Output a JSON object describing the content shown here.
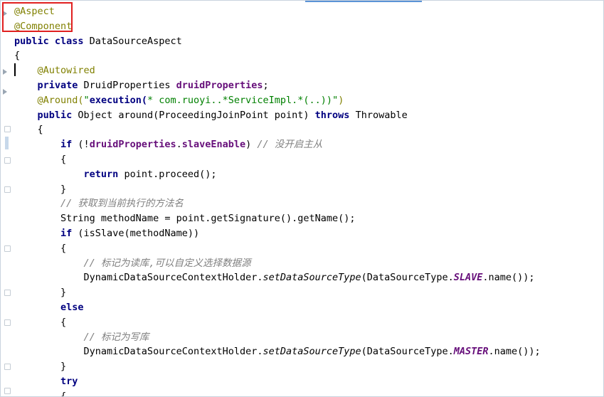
{
  "editor": {
    "lines": [
      [
        {
          "t": "@Aspect",
          "c": "ann"
        }
      ],
      [
        {
          "t": "@Component",
          "c": "ann"
        }
      ],
      [
        {
          "t": "public class ",
          "c": "kw"
        },
        {
          "t": "DataSourceAspect",
          "c": ""
        }
      ],
      [
        {
          "t": "{",
          "c": ""
        }
      ],
      [
        {
          "t": "    ",
          "c": ""
        },
        {
          "t": "@Autowired",
          "c": "ann"
        }
      ],
      [
        {
          "t": "    ",
          "c": ""
        },
        {
          "t": "private ",
          "c": "kw"
        },
        {
          "t": "DruidProperties ",
          "c": ""
        },
        {
          "t": "druidProperties",
          "c": "field"
        },
        {
          "t": ";",
          "c": ""
        }
      ],
      [
        {
          "t": "    ",
          "c": ""
        },
        {
          "t": "@Around(",
          "c": "ann"
        },
        {
          "t": "\"",
          "c": "strn"
        },
        {
          "t": "execution(",
          "c": "strb"
        },
        {
          "t": "* com.ruoyi..*ServiceImpl.*(..))",
          "c": "strn"
        },
        {
          "t": "\"",
          "c": "strn"
        },
        {
          "t": ")",
          "c": "ann"
        }
      ],
      [
        {
          "t": "    ",
          "c": ""
        },
        {
          "t": "public ",
          "c": "kw"
        },
        {
          "t": "Object around(ProceedingJoinPoint point) ",
          "c": ""
        },
        {
          "t": "throws ",
          "c": "kw"
        },
        {
          "t": "Throwable",
          "c": ""
        }
      ],
      [
        {
          "t": "    {",
          "c": ""
        }
      ],
      [
        {
          "t": "        ",
          "c": ""
        },
        {
          "t": "if ",
          "c": "kw"
        },
        {
          "t": "(!",
          "c": ""
        },
        {
          "t": "druidProperties",
          "c": "field"
        },
        {
          "t": ".",
          "c": ""
        },
        {
          "t": "slaveEnable",
          "c": "field"
        },
        {
          "t": ") ",
          "c": ""
        },
        {
          "t": "// 没开启主从",
          "c": "cmt"
        }
      ],
      [
        {
          "t": "        {",
          "c": ""
        }
      ],
      [
        {
          "t": "            ",
          "c": ""
        },
        {
          "t": "return ",
          "c": "kw"
        },
        {
          "t": "point.proceed();",
          "c": ""
        }
      ],
      [
        {
          "t": "        }",
          "c": ""
        }
      ],
      [
        {
          "t": "        ",
          "c": ""
        },
        {
          "t": "// 获取到当前执行的方法名",
          "c": "cmt"
        }
      ],
      [
        {
          "t": "        String methodName = point.getSignature().getName();",
          "c": ""
        }
      ],
      [
        {
          "t": "        ",
          "c": ""
        },
        {
          "t": "if ",
          "c": "kw"
        },
        {
          "t": "(isSlave(methodName))",
          "c": ""
        }
      ],
      [
        {
          "t": "        {",
          "c": ""
        }
      ],
      [
        {
          "t": "            ",
          "c": ""
        },
        {
          "t": "// 标记为读库,可以自定义选择数据源",
          "c": "cmt"
        }
      ],
      [
        {
          "t": "            DynamicDataSourceContextHolder.",
          "c": ""
        },
        {
          "t": "setDataSourceType",
          "c": "ital"
        },
        {
          "t": "(DataSourceType.",
          "c": ""
        },
        {
          "t": "SLAVE",
          "c": "const"
        },
        {
          "t": ".name());",
          "c": ""
        }
      ],
      [
        {
          "t": "        }",
          "c": ""
        }
      ],
      [
        {
          "t": "        ",
          "c": ""
        },
        {
          "t": "else",
          "c": "kw"
        }
      ],
      [
        {
          "t": "        {",
          "c": ""
        }
      ],
      [
        {
          "t": "            ",
          "c": ""
        },
        {
          "t": "// 标记为写库",
          "c": "cmt"
        }
      ],
      [
        {
          "t": "            DynamicDataSourceContextHolder.",
          "c": ""
        },
        {
          "t": "setDataSourceType",
          "c": "ital"
        },
        {
          "t": "(DataSourceType.",
          "c": ""
        },
        {
          "t": "MASTER",
          "c": "const"
        },
        {
          "t": ".name());",
          "c": ""
        }
      ],
      [
        {
          "t": "        }",
          "c": ""
        }
      ],
      [
        {
          "t": "        ",
          "c": ""
        },
        {
          "t": "try",
          "c": "kw"
        }
      ],
      [
        {
          "t": "        {",
          "c": ""
        }
      ]
    ]
  },
  "colors": {
    "keyword": "#000080",
    "annotation": "#808000",
    "field": "#660e7a",
    "comment": "#808080",
    "string": "#008000",
    "highlight": "#e02020"
  },
  "gutter": {
    "icons": [
      "arrow-icon",
      "fold-icon",
      "breakpoint-bar-icon"
    ]
  }
}
